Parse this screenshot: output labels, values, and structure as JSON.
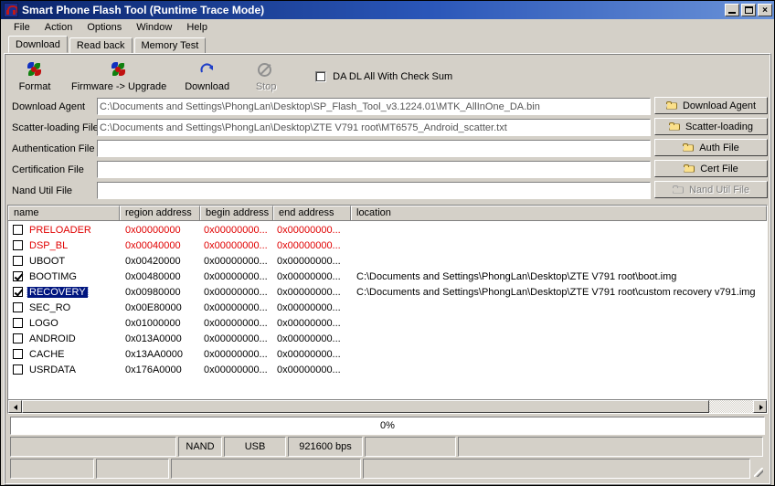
{
  "window": {
    "title": "Smart Phone Flash Tool (Runtime Trace Mode)",
    "minimize_label": "_",
    "maximize_label": "□",
    "close_label": "×"
  },
  "menubar": {
    "items": [
      {
        "label": "File"
      },
      {
        "label": "Action"
      },
      {
        "label": "Options"
      },
      {
        "label": "Window"
      },
      {
        "label": "Help"
      }
    ]
  },
  "tabs": [
    {
      "label": "Download",
      "active": true
    },
    {
      "label": "Read back",
      "active": false
    },
    {
      "label": "Memory Test",
      "active": false
    }
  ],
  "toolbar": {
    "buttons": [
      {
        "label": "Format",
        "icon": "pinwheel-icon",
        "disabled": false
      },
      {
        "label": "Firmware -> Upgrade",
        "icon": "pinwheel-icon",
        "disabled": false
      },
      {
        "label": "Download",
        "icon": "download-arrow-icon",
        "disabled": false
      },
      {
        "label": "Stop",
        "icon": "stop-icon",
        "disabled": true
      }
    ],
    "checkbox": {
      "label": "DA DL All With Check Sum",
      "checked": false
    }
  },
  "file_fields": [
    {
      "label": "Download Agent",
      "value": "C:\\Documents and Settings\\PhongLan\\Desktop\\SP_Flash_Tool_v3.1224.01\\MTK_AllInOne_DA.bin",
      "placeholder": ""
    },
    {
      "label": "Scatter-loading File",
      "value": "C:\\Documents and Settings\\PhongLan\\Desktop\\ZTE V791 root\\MT6575_Android_scatter.txt",
      "placeholder": ""
    },
    {
      "label": "Authentication File",
      "value": "",
      "placeholder": ""
    },
    {
      "label": "Certification File",
      "value": "",
      "placeholder": ""
    },
    {
      "label": "Nand Util File",
      "value": "",
      "placeholder": ""
    }
  ],
  "browse_buttons": [
    {
      "label": "Download Agent",
      "disabled": false
    },
    {
      "label": "Scatter-loading",
      "disabled": false
    },
    {
      "label": "Auth File",
      "disabled": false
    },
    {
      "label": "Cert File",
      "disabled": false
    },
    {
      "label": "Nand Util File",
      "disabled": true
    }
  ],
  "table": {
    "columns": [
      "name",
      "region address",
      "begin address",
      "end address",
      "location"
    ],
    "rows": [
      {
        "checked": false,
        "selected": false,
        "red": true,
        "name": "PRELOADER",
        "region": "0x00000000",
        "begin": "0x00000000...",
        "end": "0x00000000...",
        "location": ""
      },
      {
        "checked": false,
        "selected": false,
        "red": true,
        "name": "DSP_BL",
        "region": "0x00040000",
        "begin": "0x00000000...",
        "end": "0x00000000...",
        "location": ""
      },
      {
        "checked": false,
        "selected": false,
        "red": false,
        "name": "UBOOT",
        "region": "0x00420000",
        "begin": "0x00000000...",
        "end": "0x00000000...",
        "location": ""
      },
      {
        "checked": true,
        "selected": false,
        "red": false,
        "name": "BOOTIMG",
        "region": "0x00480000",
        "begin": "0x00000000...",
        "end": "0x00000000...",
        "location": "C:\\Documents and Settings\\PhongLan\\Desktop\\ZTE V791 root\\boot.img"
      },
      {
        "checked": true,
        "selected": true,
        "red": false,
        "name": "RECOVERY",
        "region": "0x00980000",
        "begin": "0x00000000...",
        "end": "0x00000000...",
        "location": "C:\\Documents and Settings\\PhongLan\\Desktop\\ZTE V791 root\\custom recovery v791.img"
      },
      {
        "checked": false,
        "selected": false,
        "red": false,
        "name": "SEC_RO",
        "region": "0x00E80000",
        "begin": "0x00000000...",
        "end": "0x00000000...",
        "location": ""
      },
      {
        "checked": false,
        "selected": false,
        "red": false,
        "name": "LOGO",
        "region": "0x01000000",
        "begin": "0x00000000...",
        "end": "0x00000000...",
        "location": ""
      },
      {
        "checked": false,
        "selected": false,
        "red": false,
        "name": "ANDROID",
        "region": "0x013A0000",
        "begin": "0x00000000...",
        "end": "0x00000000...",
        "location": ""
      },
      {
        "checked": false,
        "selected": false,
        "red": false,
        "name": "CACHE",
        "region": "0x13AA0000",
        "begin": "0x00000000...",
        "end": "0x00000000...",
        "location": ""
      },
      {
        "checked": false,
        "selected": false,
        "red": false,
        "name": "USRDATA",
        "region": "0x176A0000",
        "begin": "0x00000000...",
        "end": "0x00000000...",
        "location": ""
      }
    ]
  },
  "progress": {
    "text": "0%",
    "percent": 0
  },
  "statusbar": {
    "row1": [
      "",
      "NAND",
      "USB",
      "921600 bps",
      "",
      ""
    ],
    "row2": [
      "",
      "",
      "",
      ""
    ]
  },
  "colors": {
    "title_start": "#0a246a",
    "title_end": "#6a92d8",
    "face": "#d4d0c8",
    "disabled_text": "#808080",
    "red_row": "#e00000",
    "selection": "#00157f"
  }
}
